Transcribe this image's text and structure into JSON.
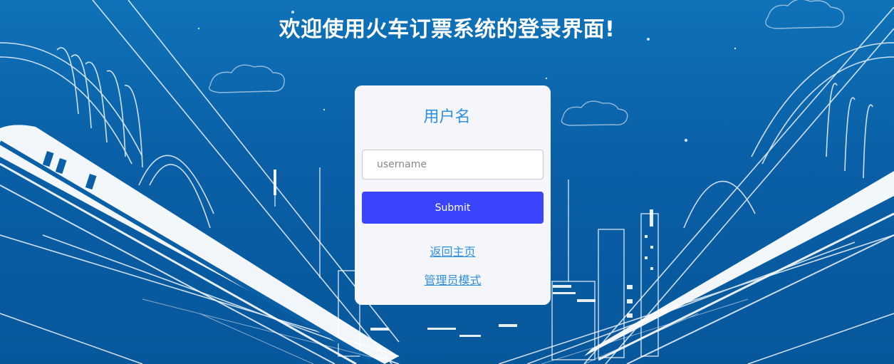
{
  "page": {
    "title": "欢迎使用火车订票系统的登录界面!"
  },
  "login": {
    "heading": "用户名",
    "username_placeholder": "username",
    "username_value": "",
    "submit_label": "Submit",
    "home_link": "返回主页",
    "admin_link": "管理员模式"
  },
  "colors": {
    "background": "#0a5fa6",
    "card_background": "#f4f6fb",
    "accent_text": "#2f8fe0",
    "submit_button": "#3a45fb"
  }
}
